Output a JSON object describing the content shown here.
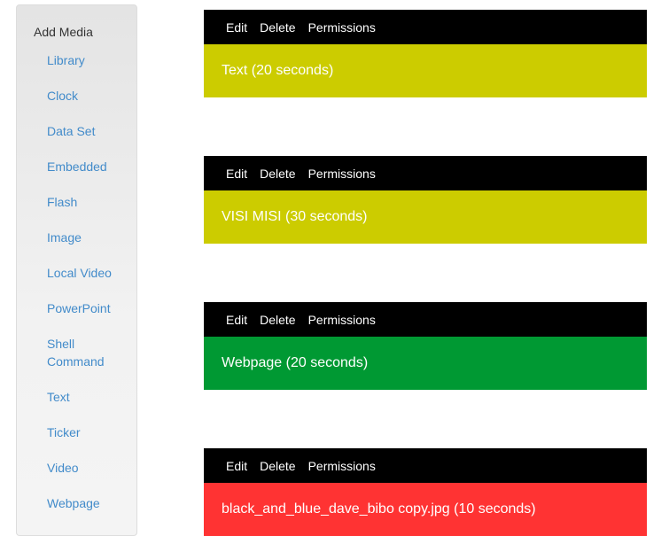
{
  "sidebar": {
    "title": "Add Media",
    "items": [
      {
        "label": "Library"
      },
      {
        "label": "Clock"
      },
      {
        "label": "Data Set"
      },
      {
        "label": "Embedded"
      },
      {
        "label": "Flash"
      },
      {
        "label": "Image"
      },
      {
        "label": "Local Video"
      },
      {
        "label": "PowerPoint"
      },
      {
        "label": "Shell Command"
      },
      {
        "label": "Text"
      },
      {
        "label": "Ticker"
      },
      {
        "label": "Video"
      },
      {
        "label": "Webpage"
      }
    ]
  },
  "regions": [
    {
      "actions": {
        "edit": "Edit",
        "delete": "Delete",
        "permissions": "Permissions"
      },
      "label": "Text (20 seconds)",
      "color": "#cccc00"
    },
    {
      "actions": {
        "edit": "Edit",
        "delete": "Delete",
        "permissions": "Permissions"
      },
      "label": "VISI MISI (30 seconds)",
      "color": "#cccc00"
    },
    {
      "actions": {
        "edit": "Edit",
        "delete": "Delete",
        "permissions": "Permissions"
      },
      "label": "Webpage (20 seconds)",
      "color": "#009933"
    },
    {
      "actions": {
        "edit": "Edit",
        "delete": "Delete",
        "permissions": "Permissions"
      },
      "label": "black_and_blue_dave_bibo copy.jpg (10 seconds)",
      "color": "#ff3333"
    }
  ]
}
